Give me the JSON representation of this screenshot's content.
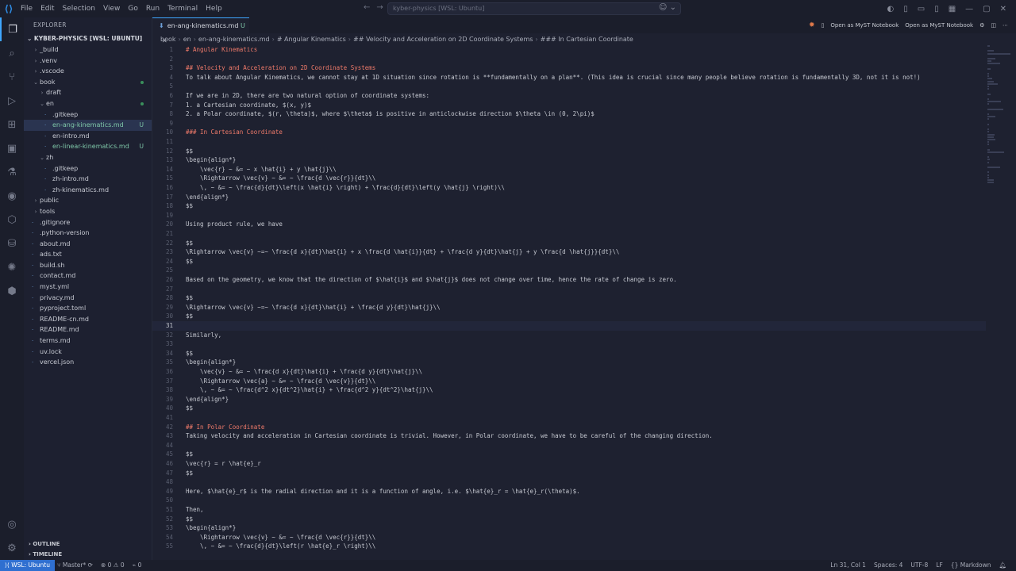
{
  "titlebar": {
    "menu": [
      "File",
      "Edit",
      "Selection",
      "View",
      "Go",
      "Run",
      "Terminal",
      "Help"
    ],
    "search": "kyber-physics [WSL: Ubuntu]"
  },
  "explorer": {
    "title": "EXPLORER",
    "root": "KYBER-PHYSICS [WSL: UBUNTU]",
    "items": [
      {
        "label": "_build",
        "depth": 0,
        "type": "folder",
        "open": false
      },
      {
        "label": ".venv",
        "depth": 0,
        "type": "folder",
        "open": false
      },
      {
        "label": ".vscode",
        "depth": 0,
        "type": "folder",
        "open": false
      },
      {
        "label": "book",
        "depth": 0,
        "type": "folder",
        "open": true,
        "modified": true
      },
      {
        "label": "draft",
        "depth": 1,
        "type": "folder",
        "open": false
      },
      {
        "label": "en",
        "depth": 1,
        "type": "folder",
        "open": true,
        "modified": true
      },
      {
        "label": ".gitkeep",
        "depth": 2,
        "type": "file"
      },
      {
        "label": "en-ang-kinematics.md",
        "depth": 2,
        "type": "file",
        "badge": "U",
        "selected": true
      },
      {
        "label": "en-intro.md",
        "depth": 2,
        "type": "file"
      },
      {
        "label": "en-linear-kinematics.md",
        "depth": 2,
        "type": "file",
        "badge": "U"
      },
      {
        "label": "zh",
        "depth": 1,
        "type": "folder",
        "open": true
      },
      {
        "label": ".gitkeep",
        "depth": 2,
        "type": "file"
      },
      {
        "label": "zh-intro.md",
        "depth": 2,
        "type": "file"
      },
      {
        "label": "zh-kinematics.md",
        "depth": 2,
        "type": "file"
      },
      {
        "label": "public",
        "depth": 0,
        "type": "folder",
        "open": false
      },
      {
        "label": "tools",
        "depth": 0,
        "type": "folder",
        "open": false
      },
      {
        "label": ".gitignore",
        "depth": 0,
        "type": "file"
      },
      {
        "label": ".python-version",
        "depth": 0,
        "type": "file"
      },
      {
        "label": "about.md",
        "depth": 0,
        "type": "file"
      },
      {
        "label": "ads.txt",
        "depth": 0,
        "type": "file"
      },
      {
        "label": "build.sh",
        "depth": 0,
        "type": "file"
      },
      {
        "label": "contact.md",
        "depth": 0,
        "type": "file"
      },
      {
        "label": "myst.yml",
        "depth": 0,
        "type": "file"
      },
      {
        "label": "privacy.md",
        "depth": 0,
        "type": "file"
      },
      {
        "label": "pyproject.toml",
        "depth": 0,
        "type": "file"
      },
      {
        "label": "README-cn.md",
        "depth": 0,
        "type": "file"
      },
      {
        "label": "README.md",
        "depth": 0,
        "type": "file"
      },
      {
        "label": "terms.md",
        "depth": 0,
        "type": "file"
      },
      {
        "label": "uv.lock",
        "depth": 0,
        "type": "file"
      },
      {
        "label": "vercel.json",
        "depth": 0,
        "type": "file"
      }
    ],
    "outline": "OUTLINE",
    "timeline": "TIMELINE"
  },
  "tab": {
    "label": "en-ang-kinematics.md",
    "status": "U"
  },
  "tab_actions": [
    "Open as MyST Notebook",
    "Open as MyST Notebook"
  ],
  "breadcrumb": [
    "book",
    "en",
    "en-ang-kinematics.md",
    "# Angular Kinematics",
    "## Velocity and Acceleration on 2D Coordinate Systems",
    "### In Cartesian Coordinate"
  ],
  "editor": {
    "current_line": 31,
    "lines": [
      "# Angular Kinematics",
      "",
      "## Velocity and Acceleration on 2D Coordinate Systems",
      "To talk about Angular Kinematics, we cannot stay at 1D situation since rotation is **fundamentally on a plan**. (This idea is crucial since many people believe rotation is fundamentally 3D, not it is not!)",
      "",
      "If we are in 2D, there are two natural option of coordinate systems:",
      "1. a Cartesian coordinate, $(x, y)$",
      "2. a Polar coordinate, $(r, \\theta)$, where $\\theta$ is positive in anticlockwise direction $\\theta \\in (0, 2\\pi)$",
      "",
      "### In Cartesian Coordinate",
      "",
      "$$",
      "\\begin{align*}",
      "    \\vec{r} ~ &= ~ x \\hat{i} + y \\hat{j}\\\\",
      "    \\Rightarrow \\vec{v} ~ &= ~ \\frac{d \\vec{r}}{dt}\\\\",
      "    \\, ~ &= ~ \\frac{d}{dt}\\left(x \\hat{i} \\right) + \\frac{d}{dt}\\left(y \\hat{j} \\right)\\\\",
      "\\end{align*}",
      "$$",
      "",
      "Using product rule, we have",
      "",
      "$$",
      "\\Rightarrow \\vec{v} ~=~ \\frac{d x}{dt}\\hat{i} + x \\frac{d \\hat{i}}{dt} + \\frac{d y}{dt}\\hat{j} + y \\frac{d \\hat{j}}{dt}\\\\",
      "$$",
      "",
      "Based on the geometry, we know that the direction of $\\hat{i}$ and $\\hat{j}$ does not change over time, hence the rate of change is zero.",
      "",
      "$$",
      "\\Rightarrow \\vec{v} ~=~ \\frac{d x}{dt}\\hat{i} + \\frac{d y}{dt}\\hat{j}\\\\",
      "$$",
      "",
      "Similarly,",
      "",
      "$$",
      "\\begin{align*}",
      "    \\vec{v} ~ &= ~ \\frac{d x}{dt}\\hat{i} + \\frac{d y}{dt}\\hat{j}\\\\",
      "    \\Rightarrow \\vec{a} ~ &= ~ \\frac{d \\vec{v}}{dt}\\\\",
      "    \\, ~ &= ~ \\frac{d^2 x}{dt^2}\\hat{i} + \\frac{d^2 y}{dt^2}\\hat{j}\\\\",
      "\\end{align*}",
      "$$",
      "",
      "## In Polar Coordinate",
      "Taking velocity and acceleration in Cartesian coordinate is trivial. However, in Polar coordinate, we have to be careful of the changing direction.",
      "",
      "$$",
      "\\vec{r} = r \\hat{e}_r",
      "$$",
      "",
      "Here, $\\hat{e}_r$ is the radial direction and it is a function of angle, i.e. $\\hat{e}_r = \\hat{e}_r(\\theta)$.",
      "",
      "Then,",
      "$$",
      "\\begin{align*}",
      "    \\Rightarrow \\vec{v} ~ &= ~ \\frac{d \\vec{r}}{dt}\\\\",
      "    \\, ~ &= ~ \\frac{d}{dt}\\left(r \\hat{e}_r \\right)\\\\"
    ]
  },
  "statusbar": {
    "remote": "WSL: Ubuntu",
    "branch": "Master*",
    "problems": "⊗ 0 ⚠ 0",
    "ports": "⌁ 0",
    "position": "Ln 31, Col 1",
    "spaces": "Spaces: 4",
    "encoding": "UTF-8",
    "eol": "LF",
    "language": "Markdown"
  }
}
